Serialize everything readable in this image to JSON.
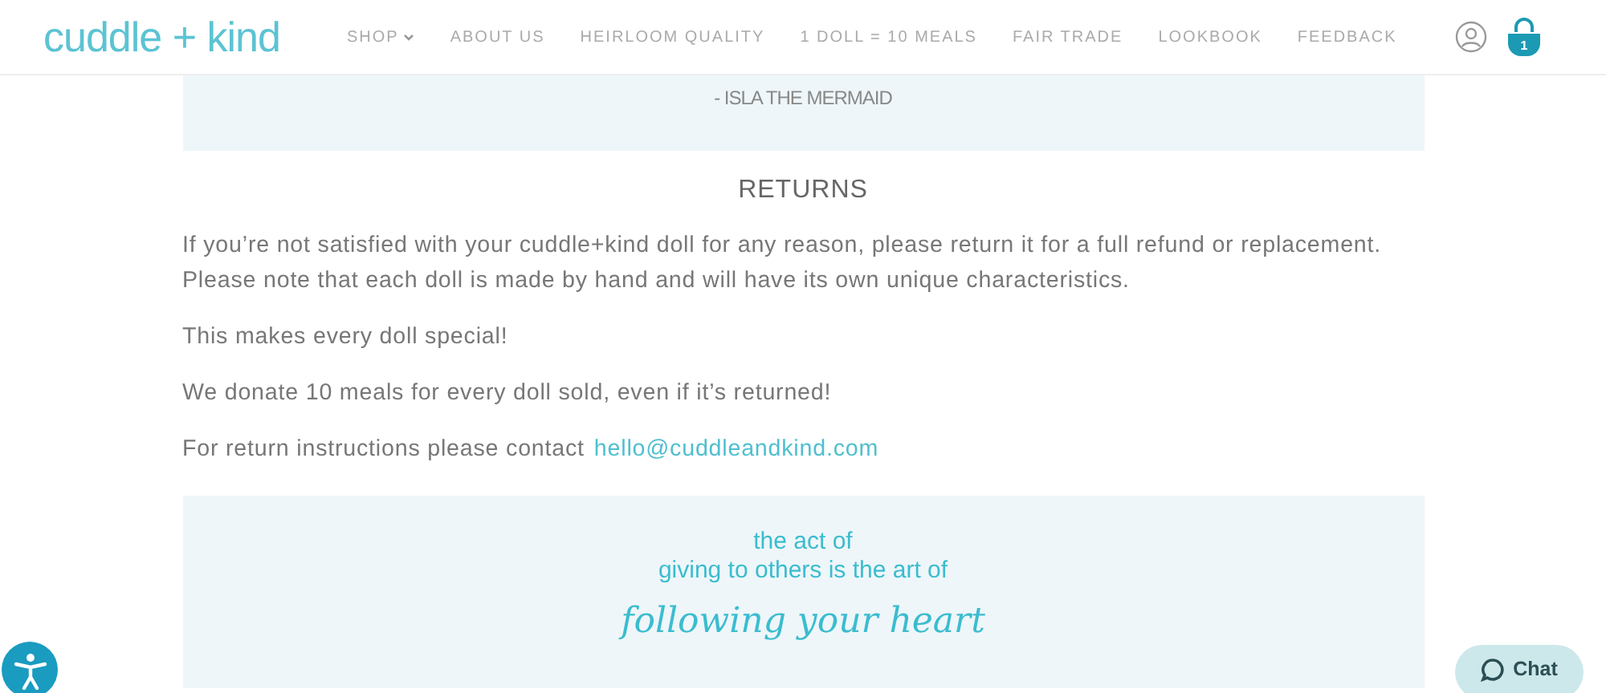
{
  "header": {
    "logo": "cuddle + kind",
    "nav": [
      {
        "label": "SHOP",
        "dropdown": true
      },
      {
        "label": "ABOUT US",
        "dropdown": false
      },
      {
        "label": "HEIRLOOM QUALITY",
        "dropdown": false
      },
      {
        "label": "1 DOLL = 10 MEALS",
        "dropdown": false
      },
      {
        "label": "FAIR TRADE",
        "dropdown": false
      },
      {
        "label": "LOOKBOOK",
        "dropdown": false
      },
      {
        "label": "FEEDBACK",
        "dropdown": false
      }
    ],
    "cart_count": "1"
  },
  "quote": {
    "attribution": "- ISLA THE MERMAID"
  },
  "returns": {
    "title": "RETURNS",
    "paragraphs": [
      "If you’re not satisfied with your cuddle+kind doll for any reason, please return it for a full refund or replacement. Please note that each doll is made by hand and will have its own unique characteristics.",
      "This makes every doll special!",
      "We donate 10 meals for every doll sold, even if it’s returned!"
    ],
    "contact": {
      "text": "For return instructions please contact",
      "email": "hello@cuddleandkind.com"
    }
  },
  "banner": {
    "lines": [
      "the act of",
      "giving to others is the art of"
    ],
    "script": "following your heart"
  },
  "chat": {
    "label": "Chat"
  }
}
